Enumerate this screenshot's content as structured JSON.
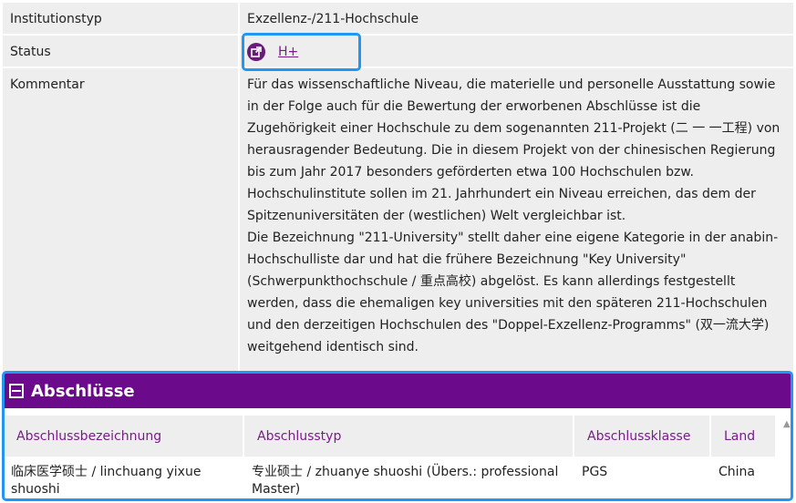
{
  "info": {
    "type_label": "Institutionstyp",
    "type_value": "Exzellenz-/211-Hochschule",
    "status_label": "Status",
    "status_value": "H+",
    "status_icon": "external-link-icon",
    "comment_label": "Kommentar",
    "comment_lines": [
      "Für das wissenschaftliche Niveau, die materielle und personelle Ausstattung sowie",
      "in der Folge auch für die Bewertung der erworbenen Abschlüsse ist die",
      "Zugehörigkeit einer Hochschule zu dem sogenannten 211-Projekt (二 一 一工程) von",
      "herausragender Bedeutung. Die in diesem Projekt von der chinesischen Regierung",
      "bis zum Jahr 2017 besonders geförderten etwa 100 Hochschulen bzw.",
      "Hochschulinstitute sollen im 21. Jahrhundert ein Niveau erreichen, das dem der",
      "Spitzenuniversitäten der (westlichen) Welt vergleichbar ist.",
      "Die Bezeichnung \"211-University\" stellt daher eine eigene Kategorie in der anabin-",
      "Hochschulliste dar und hat die frühere Bezeichnung \"Key University\"",
      "(Schwerpunkthochschule / 重点高校) abgelöst. Es kann allerdings festgestellt",
      "werden, dass die ehemaligen key universities mit den späteren 211-Hochschulen",
      "und den derzeitigen Hochschulen des \"Doppel-Exzellenz-Programms\" (双一流大学)",
      "weitgehend identisch sind."
    ]
  },
  "section": {
    "title": "Abschlüsse",
    "columns": [
      "Abschlussbezeichnung",
      "Abschlusstyp",
      "Abschlussklasse",
      "Land"
    ],
    "rows": [
      [
        "临床医学硕士 / linchuang yixue shuoshi",
        "专业硕士 / zhuanye shuoshi (Übers.: professional Master)",
        "PGS",
        "China"
      ]
    ]
  },
  "colors": {
    "accent": "#6b0a8a",
    "link": "#7a1b8b",
    "highlight": "#2196f3",
    "cell_bg": "#eeeeee"
  }
}
